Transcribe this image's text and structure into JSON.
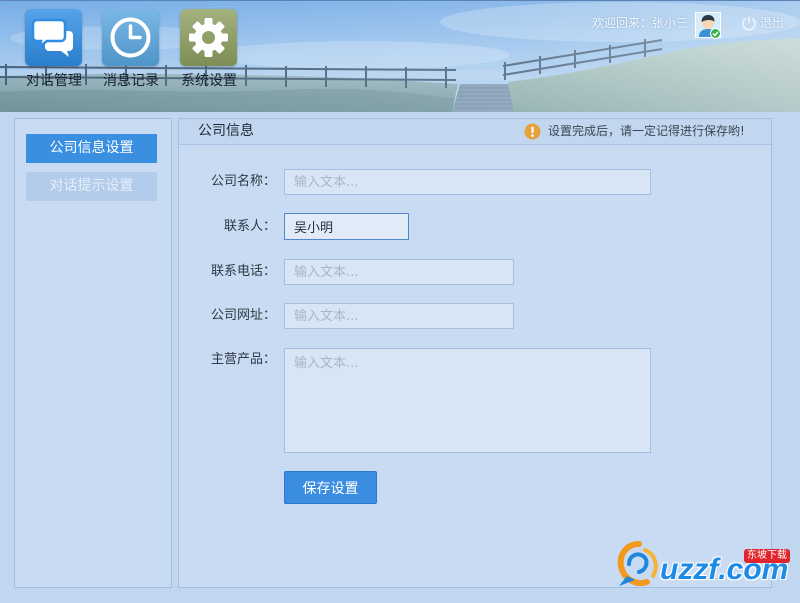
{
  "header": {
    "nav": [
      {
        "label": "对话管理",
        "icon": "chat-bubbles-icon",
        "color": "#2e8ce3",
        "active": true
      },
      {
        "label": "消息记录",
        "icon": "clock-icon",
        "color": "#58a6df",
        "active": false
      },
      {
        "label": "系统设置",
        "icon": "gear-icon",
        "color": "#8c9e5f",
        "active": false
      }
    ],
    "welcome": "欢迎回来：张小三",
    "avatar_icon": "user-avatar-icon",
    "logout": {
      "label": "退出",
      "icon": "power-icon"
    }
  },
  "sidebar": {
    "items": [
      {
        "label": "公司信息设置",
        "active": true
      },
      {
        "label": "对话提示设置",
        "active": false
      }
    ]
  },
  "panel": {
    "title": "公司信息",
    "notice": {
      "icon": "warning-icon",
      "text": "设置完成后，请一定记得进行保存哟!"
    },
    "form": {
      "fields": [
        {
          "label": "公司名称：",
          "placeholder": "输入文本..."
        },
        {
          "label": "联系人：",
          "value": "吴小明",
          "focused": true
        },
        {
          "label": "联系电话：",
          "placeholder": "输入文本..."
        },
        {
          "label": "公司网址：",
          "placeholder": "输入文本..."
        },
        {
          "label": "主营产品：",
          "placeholder": "输入文本..."
        }
      ],
      "submit_label": "保存设置"
    }
  },
  "theme": {
    "accent": "#3b8fe1",
    "background": "#c1d6ef",
    "warning": "#e6a23a"
  },
  "watermark": {
    "brand": "uzzf.com",
    "badge": "东坡下载"
  }
}
